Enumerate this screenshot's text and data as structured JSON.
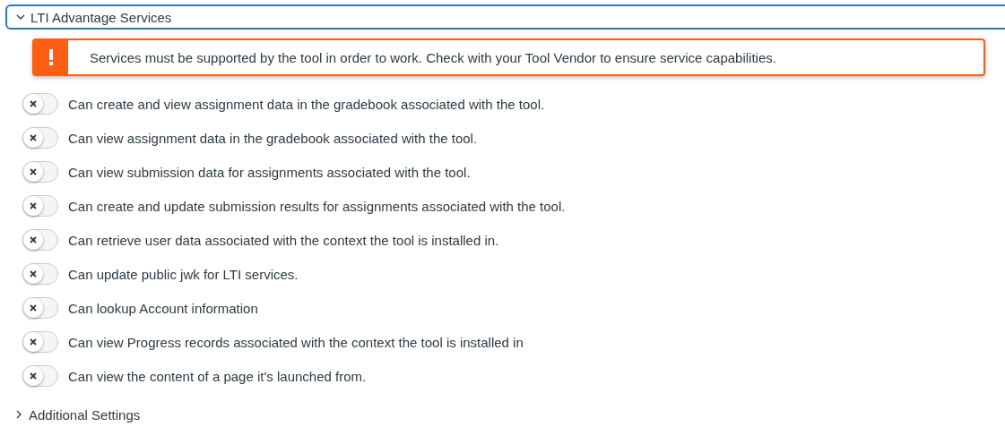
{
  "section": {
    "title": "LTI Advantage Services",
    "expanded": true
  },
  "alert": {
    "message": "Services must be supported by the tool in order to work. Check with your Tool Vendor to ensure service capabilities."
  },
  "services": [
    {
      "label": "Can create and view assignment data in the gradebook associated with the tool.",
      "on": false
    },
    {
      "label": "Can view assignment data in the gradebook associated with the tool.",
      "on": false
    },
    {
      "label": "Can view submission data for assignments associated with the tool.",
      "on": false
    },
    {
      "label": "Can create and update submission results for assignments associated with the tool.",
      "on": false
    },
    {
      "label": "Can retrieve user data associated with the context the tool is installed in.",
      "on": false
    },
    {
      "label": "Can update public jwk for LTI services.",
      "on": false
    },
    {
      "label": "Can lookup Account information",
      "on": false
    },
    {
      "label": "Can view Progress records associated with the context the tool is installed in",
      "on": false
    },
    {
      "label": "Can view the content of a page it's launched from.",
      "on": false
    }
  ],
  "next_section": {
    "title": "Additional Settings",
    "expanded": false
  }
}
